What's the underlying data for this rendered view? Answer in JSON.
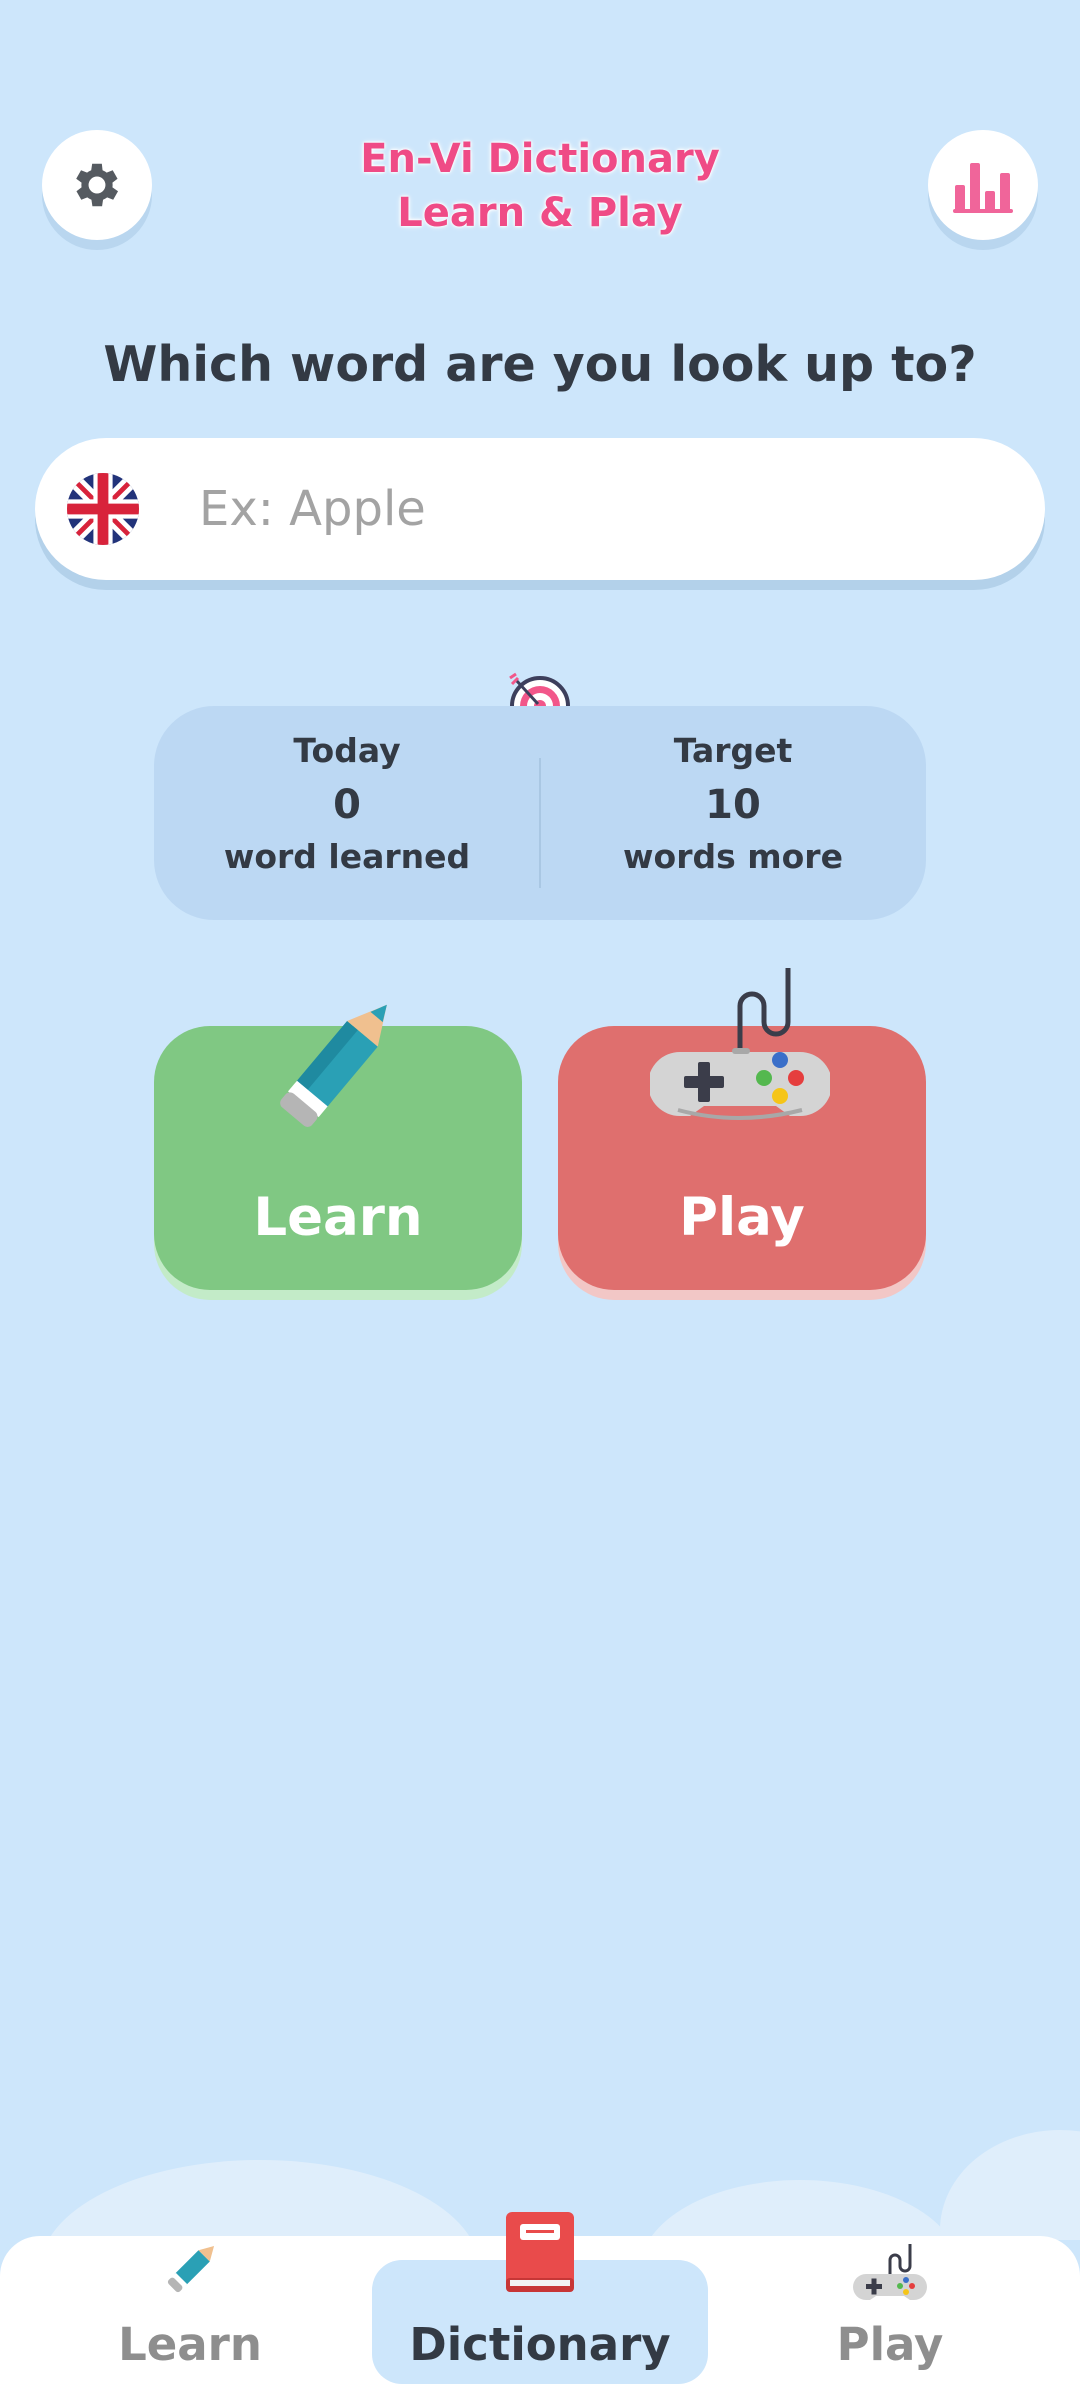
{
  "header": {
    "title_line1": "En-Vi Dictionary",
    "title_line2": "Learn & Play",
    "settings_icon": "gear-icon",
    "stats_icon": "bar-chart-icon"
  },
  "search": {
    "question": "Which word are you look up to?",
    "placeholder": "Ex: Apple",
    "value": "",
    "flag_icon": "uk-flag-icon"
  },
  "stats": {
    "today_label": "Today",
    "today_count": "0",
    "today_sub": "word learned",
    "target_label": "Target",
    "target_count": "10",
    "target_sub": "words more"
  },
  "actions": {
    "learn_label": "Learn",
    "play_label": "Play"
  },
  "nav": {
    "items": [
      {
        "label": "Learn",
        "icon": "pencil-icon",
        "active": false
      },
      {
        "label": "Dictionary",
        "icon": "book-icon",
        "active": true
      },
      {
        "label": "Play",
        "icon": "gamepad-icon",
        "active": false
      }
    ]
  },
  "colors": {
    "background": "#cde6fb",
    "title_pink": "#ef4b86",
    "learn_green": "#80c883",
    "play_red": "#df6f6e",
    "text_dark": "#333a44"
  }
}
